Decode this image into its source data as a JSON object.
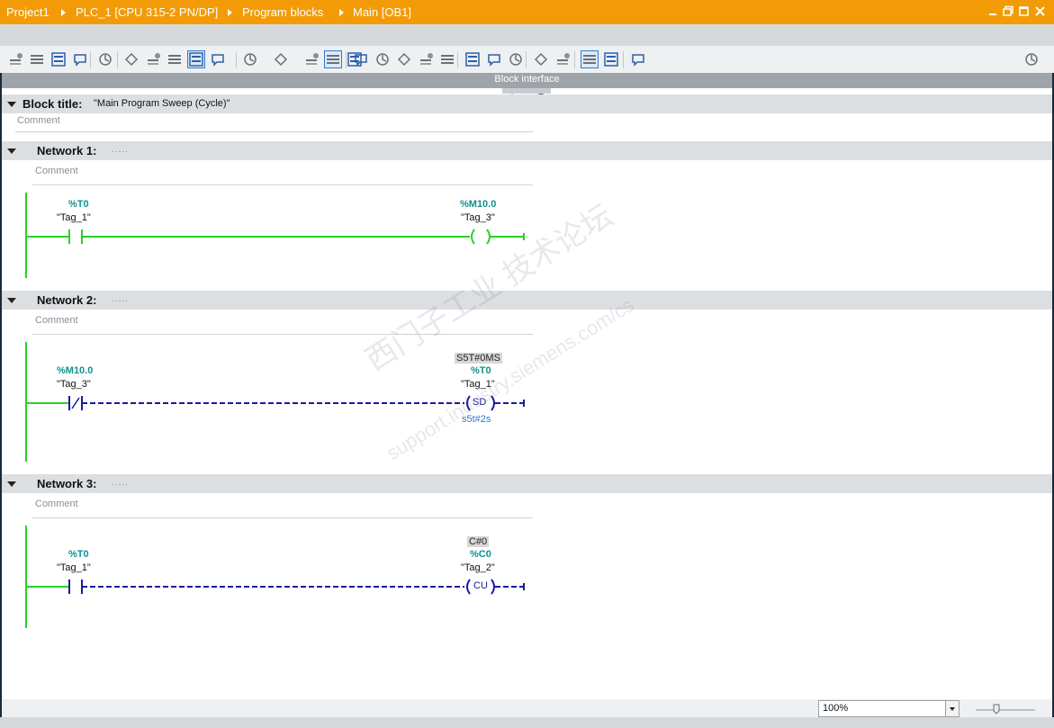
{
  "breadcrumb": [
    "Project1",
    "PLC_1 [CPU 315-2 PN/DP]",
    "Program blocks",
    "Main [OB1]"
  ],
  "window_controls": [
    "minimize",
    "restore",
    "maximize",
    "close"
  ],
  "toolbar": {
    "icons": [
      "insert-network-icon",
      "delete-network-icon",
      "insert-row-icon",
      "add-row-icon",
      "go-online-icon",
      "align-left-icon",
      "absolute-operands-icon",
      "symbolic-operands-icon",
      "comments-toggle-icon",
      "network-comments-icon",
      "favorites-icon",
      "empty-box-icon",
      "open-branch-icon",
      "list-view-icon",
      "star-icon",
      "go-to-previous-error-icon",
      "go-to-next-error-icon",
      "monitoring-icon",
      "modify-icon",
      "force-icon",
      "previous-network-icon",
      "next-network-icon",
      "collapse-icon",
      "reset-start-icon",
      "open-close-icon",
      "compare-icon",
      "download-icon",
      "check-icon",
      "split-view-icon"
    ]
  },
  "block_interface": {
    "label": "Block interface"
  },
  "block": {
    "title_label": "Block title:",
    "title": "\"Main Program Sweep (Cycle)\"",
    "comment": "Comment"
  },
  "networks": [
    {
      "title": "Network 1:",
      "dots": ".....",
      "comment": "Comment",
      "contact": {
        "address": "%T0",
        "tag": "\"Tag_1\""
      },
      "coil": {
        "address": "%M10.0",
        "tag": "\"Tag_3\""
      }
    },
    {
      "title": "Network 2:",
      "dots": ".....",
      "comment": "Comment",
      "contact": {
        "address": "%M10.0",
        "tag": "\"Tag_3\""
      },
      "coil": {
        "preset": "S5T#0MS",
        "address": "%T0",
        "tag": "\"Tag_1\"",
        "label": "SD",
        "param": "s5t#2s"
      }
    },
    {
      "title": "Network 3:",
      "dots": ".....",
      "comment": "Comment",
      "contact": {
        "address": "%T0",
        "tag": "\"Tag_1\""
      },
      "coil": {
        "preset": "C#0",
        "address": "%C0",
        "tag": "\"Tag_2\"",
        "label": "CU"
      }
    }
  ],
  "status": {
    "zoom": "100%"
  },
  "watermark": {
    "line1": "西门子工业 技术论坛",
    "line2": "support.industry.siemens.com/cs"
  },
  "colors": {
    "title_bar": "#f39b06",
    "rail_green": "#26d226",
    "rlo_blue": "#1a1aa0",
    "address_teal": "#138f8f"
  }
}
